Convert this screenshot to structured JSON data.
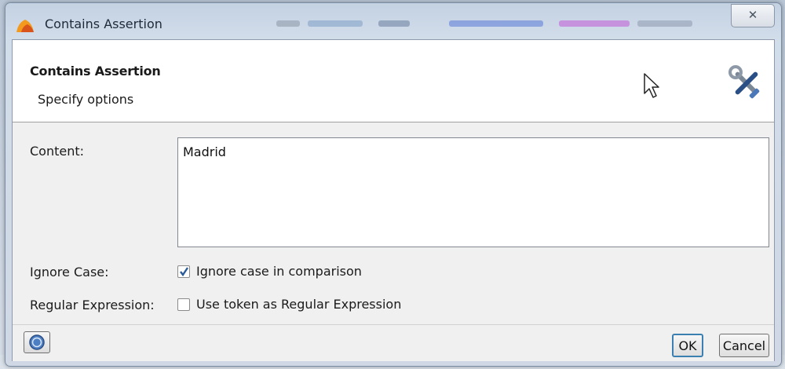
{
  "window": {
    "title": "Contains Assertion",
    "close_symbol": "✕"
  },
  "header": {
    "title": "Contains Assertion",
    "subtitle": "Specify options",
    "icon": "tools-icon"
  },
  "form": {
    "content_label": "Content:",
    "content_value": "Madrid",
    "ignore_case_label": "Ignore Case:",
    "ignore_case_option": "Ignore case in comparison",
    "ignore_case_checked": true,
    "regex_label": "Regular Expression:",
    "regex_option": "Use token as Regular Expression",
    "regex_checked": false
  },
  "footer": {
    "help_icon": "help-icon",
    "ok_label": "OK",
    "cancel_label": "Cancel"
  },
  "colors": {
    "accent": "#3c7fb1",
    "title_bar": "#c3d1e2"
  }
}
